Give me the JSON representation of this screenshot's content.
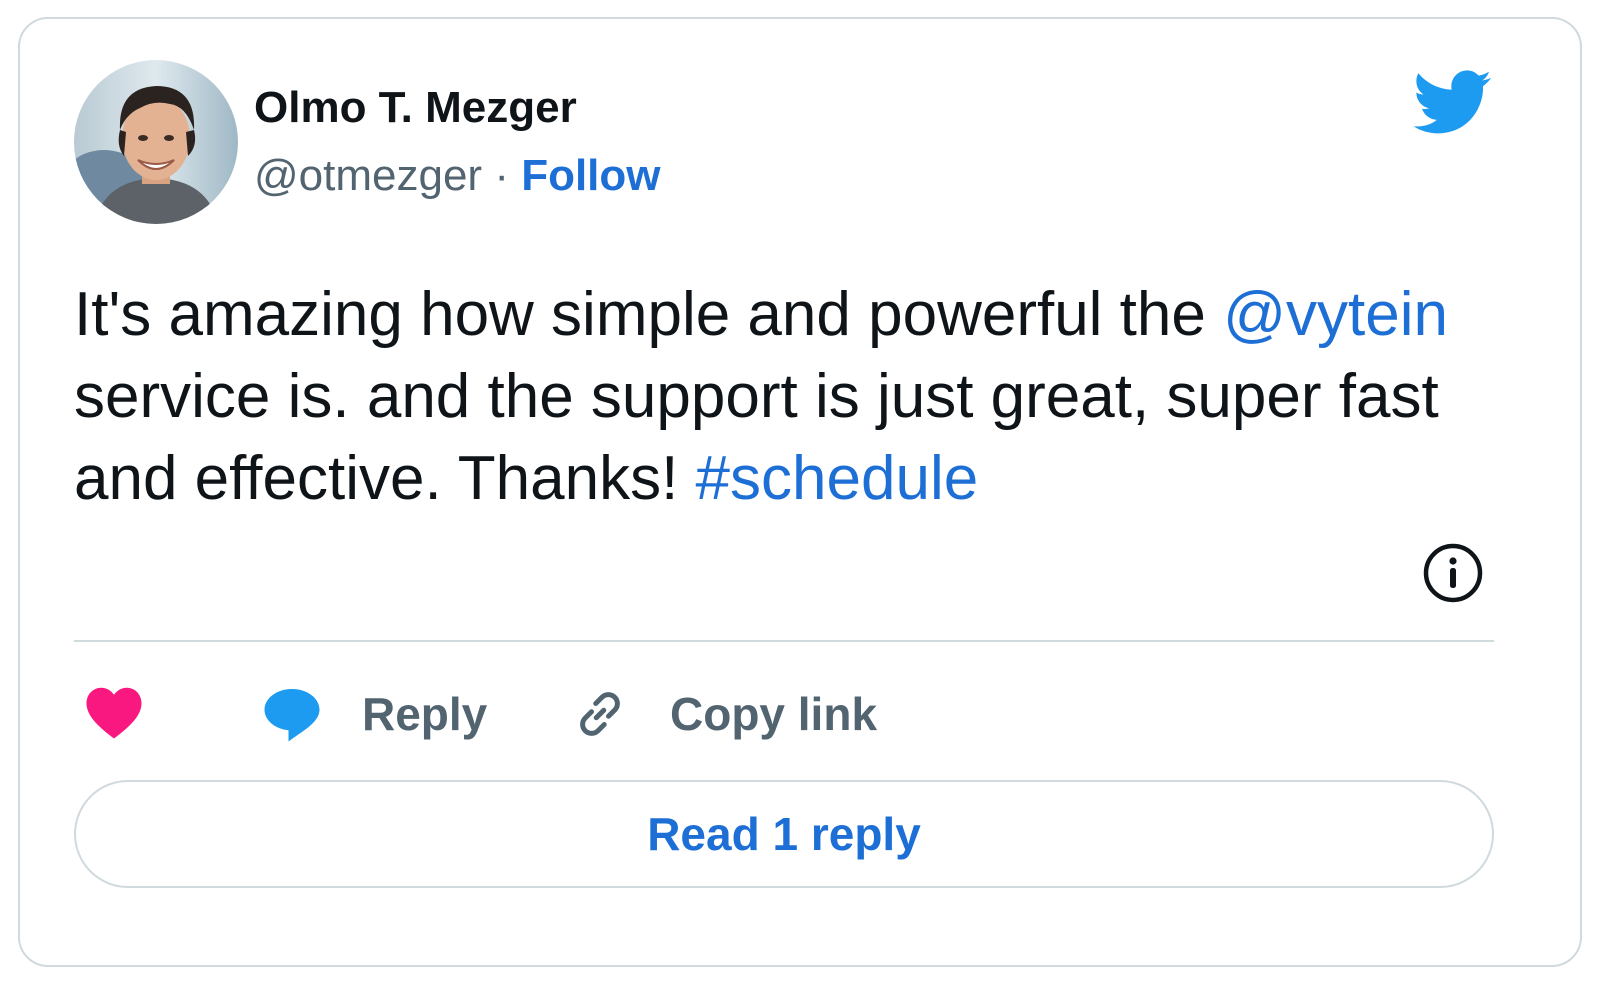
{
  "author": {
    "name": "Olmo T. Mezger",
    "handle": "@otmezger",
    "separator": "·",
    "follow_label": "Follow"
  },
  "tweet": {
    "text_part1": "It's amazing how simple and powerful the ",
    "mention": "@vytein",
    "text_part2": " service is. and the support is just great, super fast and effective. Thanks! ",
    "hashtag": "#schedule"
  },
  "actions": {
    "like_icon": "heart-icon",
    "reply_label": "Reply",
    "copy_link_label": "Copy link"
  },
  "read_replies_label": "Read 1 reply",
  "colors": {
    "link": "#1d6fd6",
    "twitter_blue": "#1d9bf0",
    "like_pink": "#f91880",
    "text": "#0f1419",
    "muted": "#536471",
    "border": "#cfd9de"
  }
}
